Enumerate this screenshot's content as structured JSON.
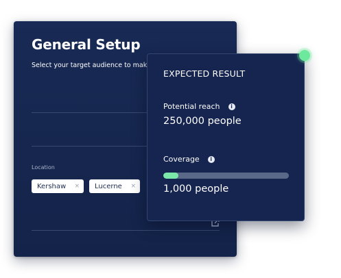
{
  "setup": {
    "title": "General Setup",
    "subtitle": "Select your target audience to make Ad more effective",
    "location_label": "Location",
    "chips": [
      {
        "label": "Kershaw",
        "remove": "×"
      },
      {
        "label": "Lucerne",
        "remove": "×"
      }
    ]
  },
  "result": {
    "title": "EXPECTED RESULT",
    "reach": {
      "label": "Potential reach",
      "info": "i",
      "value": "250,000 people"
    },
    "coverage": {
      "label": "Coverage",
      "info": "i",
      "value": "1,000 people",
      "progress_fraction": 0.12
    }
  },
  "colors": {
    "card_bg": "#182a55",
    "result_bg": "#162550",
    "accent_green": "#79e8a8",
    "status_dot": "#6ee89c",
    "track": "#5a6987"
  },
  "icons": {
    "chip_remove": "close-icon",
    "info": "info-icon",
    "export": "export-icon"
  }
}
